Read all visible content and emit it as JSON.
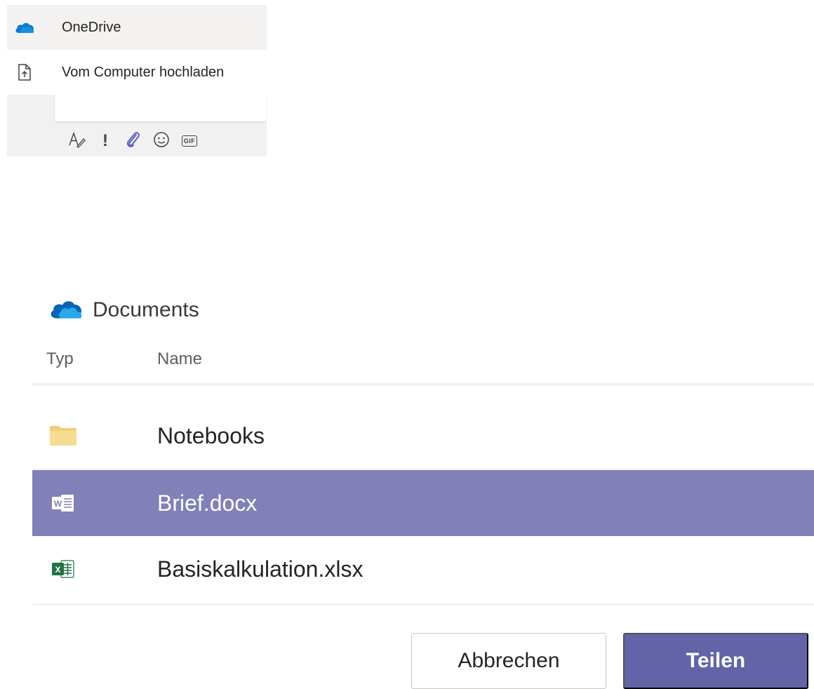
{
  "attach_menu": {
    "items": [
      {
        "label": "OneDrive",
        "icon": "onedrive-cloud-icon"
      },
      {
        "label": "Vom Computer hochladen",
        "icon": "upload-file-icon"
      }
    ],
    "toolbar": [
      {
        "name": "format-icon"
      },
      {
        "name": "important-icon",
        "glyph": "!"
      },
      {
        "name": "attach-icon"
      },
      {
        "name": "emoji-icon"
      },
      {
        "name": "gif-icon",
        "glyph": "GIF"
      }
    ]
  },
  "file_dialog": {
    "location": "Documents",
    "columns": {
      "type": "Typ",
      "name": "Name"
    },
    "files": [
      {
        "name": "Notebooks",
        "kind": "folder-icon"
      },
      {
        "name": "Brief.docx",
        "kind": "word-file-icon",
        "selected": true
      },
      {
        "name": "Basiskalkulation.xlsx",
        "kind": "excel-file-icon"
      }
    ],
    "buttons": {
      "cancel": "Abbrechen",
      "share": "Teilen"
    }
  },
  "colors": {
    "accent": "#6264a7",
    "selected_row": "#8280b8",
    "onedrive_blue": "#0f78d4",
    "folder": "#f0cf7a",
    "word": "#2b579a",
    "excel": "#217346"
  }
}
